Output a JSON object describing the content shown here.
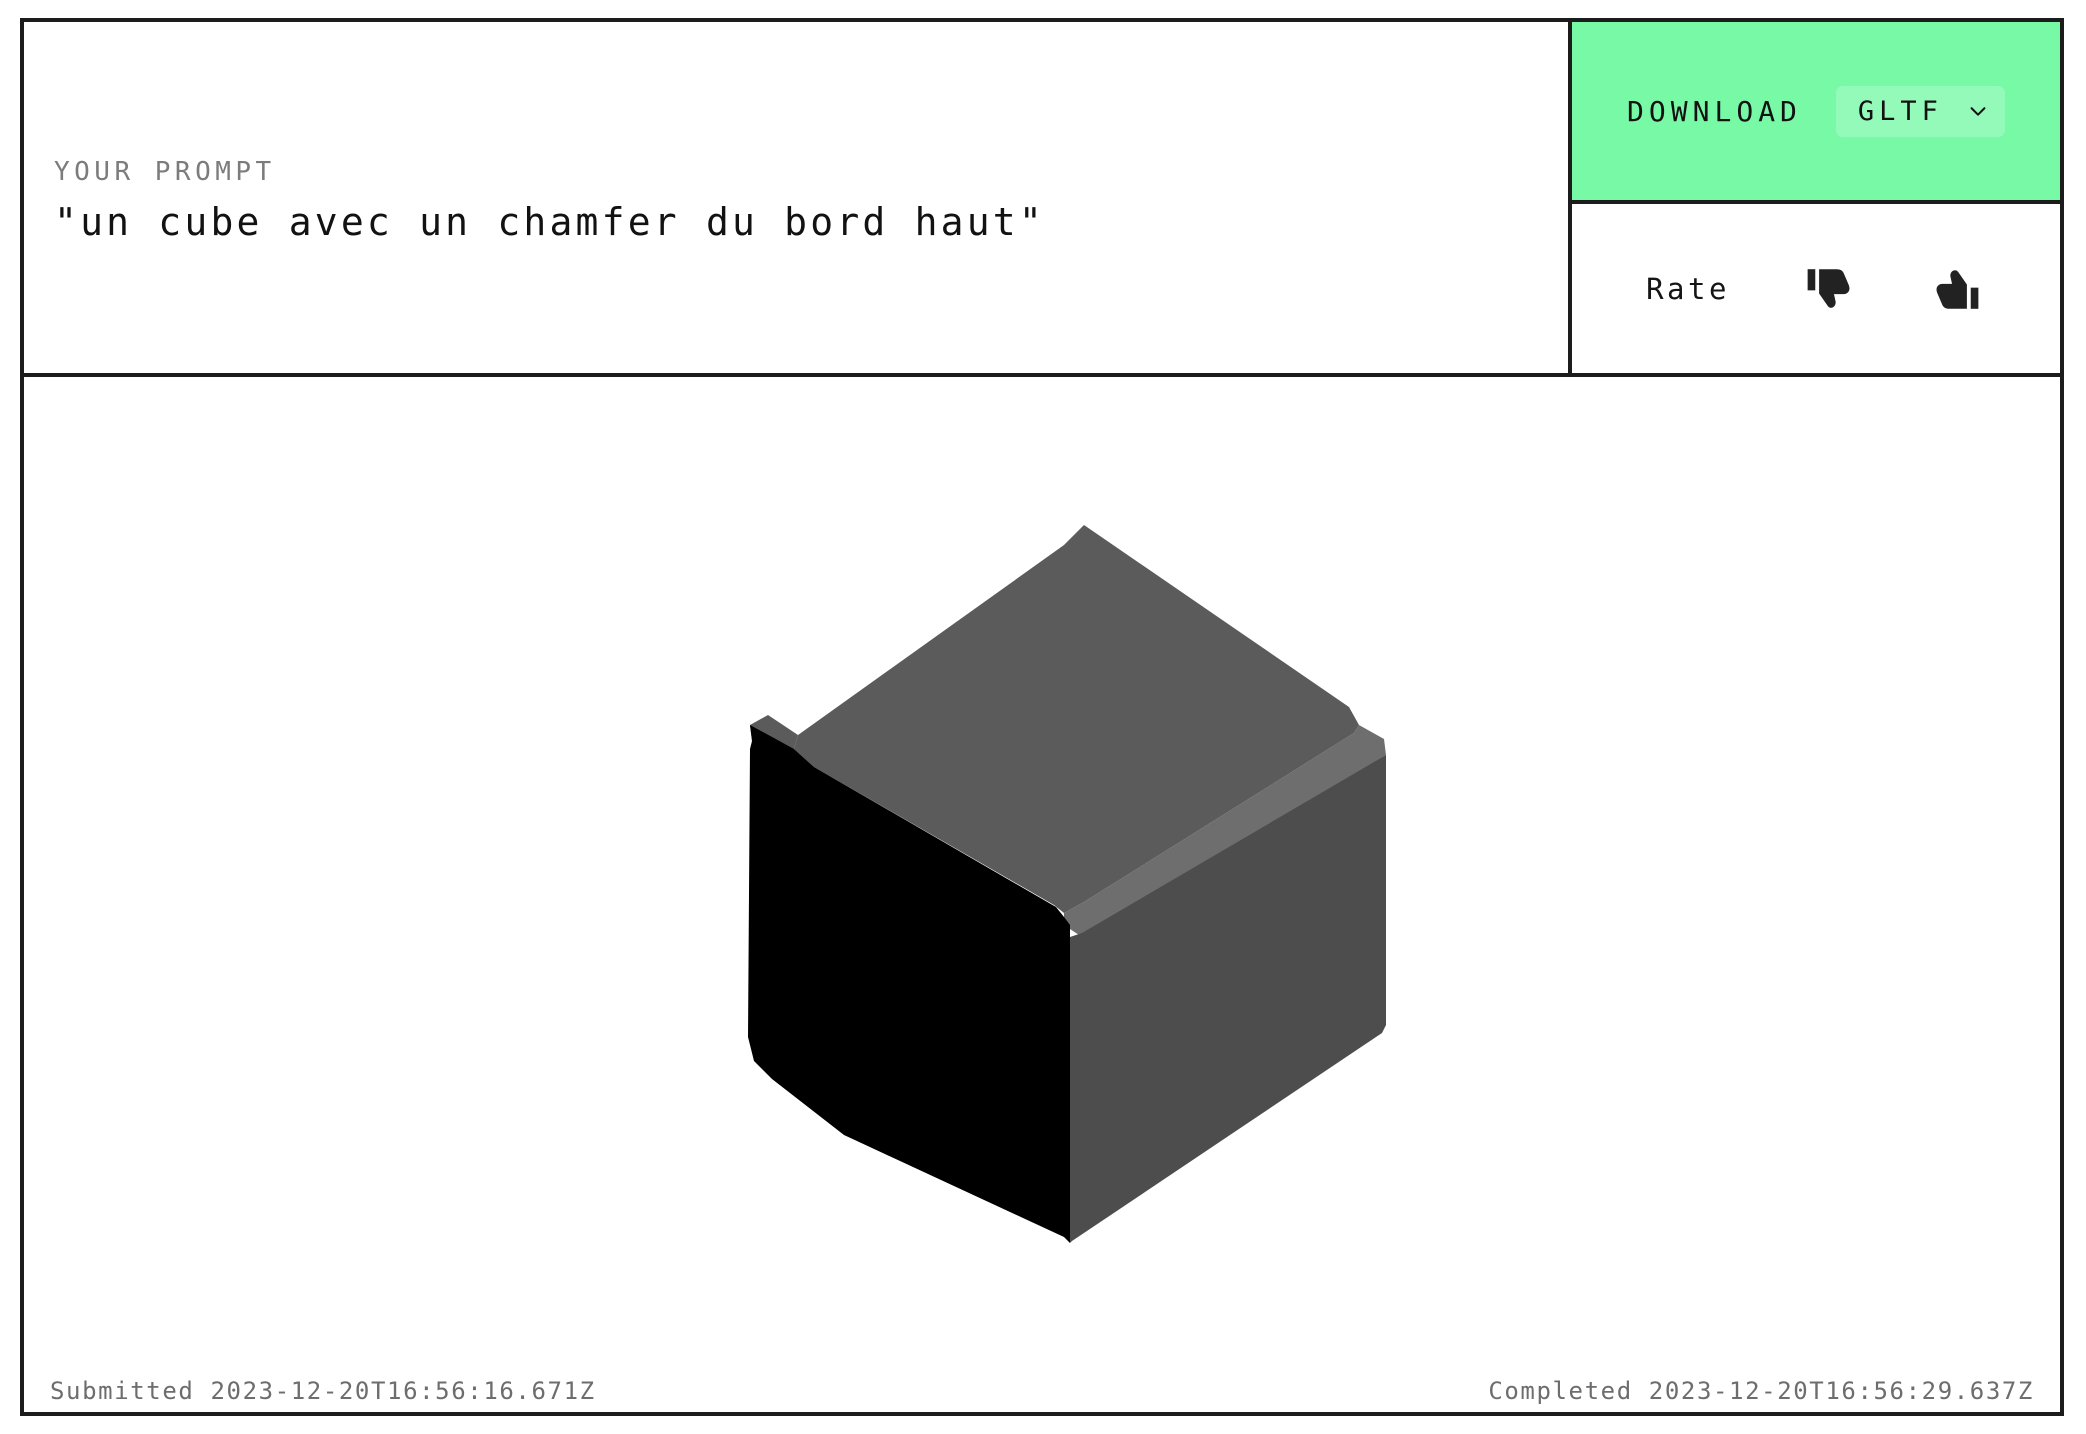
{
  "prompt": {
    "label": "YOUR PROMPT",
    "text": "\"un cube avec un chamfer du bord haut\""
  },
  "download": {
    "label": "DOWNLOAD",
    "format_value": "GLTF",
    "format_options": [
      "GLTF"
    ],
    "chevron_icon": "chevron-down-icon",
    "background_color": "#77F9A6"
  },
  "rate": {
    "label": "Rate",
    "thumbs_down_icon": "thumbs-down-icon",
    "thumbs_up_icon": "thumbs-up-icon"
  },
  "viewer": {
    "model_description": "chamfered cube 3d model",
    "top_face_color": "#545454",
    "chamfer_face_color": "#6B6B6B",
    "right_face_color": "#4D4D4D",
    "left_face_color": "#000000",
    "background_color": "#FFFFFF"
  },
  "footer": {
    "submitted": "Submitted 2023-12-20T16:56:16.671Z",
    "completed": "Completed 2023-12-20T16:56:29.637Z"
  },
  "theme": {
    "border_color": "#1C1C1C",
    "accent_green": "#77F9A6",
    "muted_text": "#7C7C7C"
  }
}
